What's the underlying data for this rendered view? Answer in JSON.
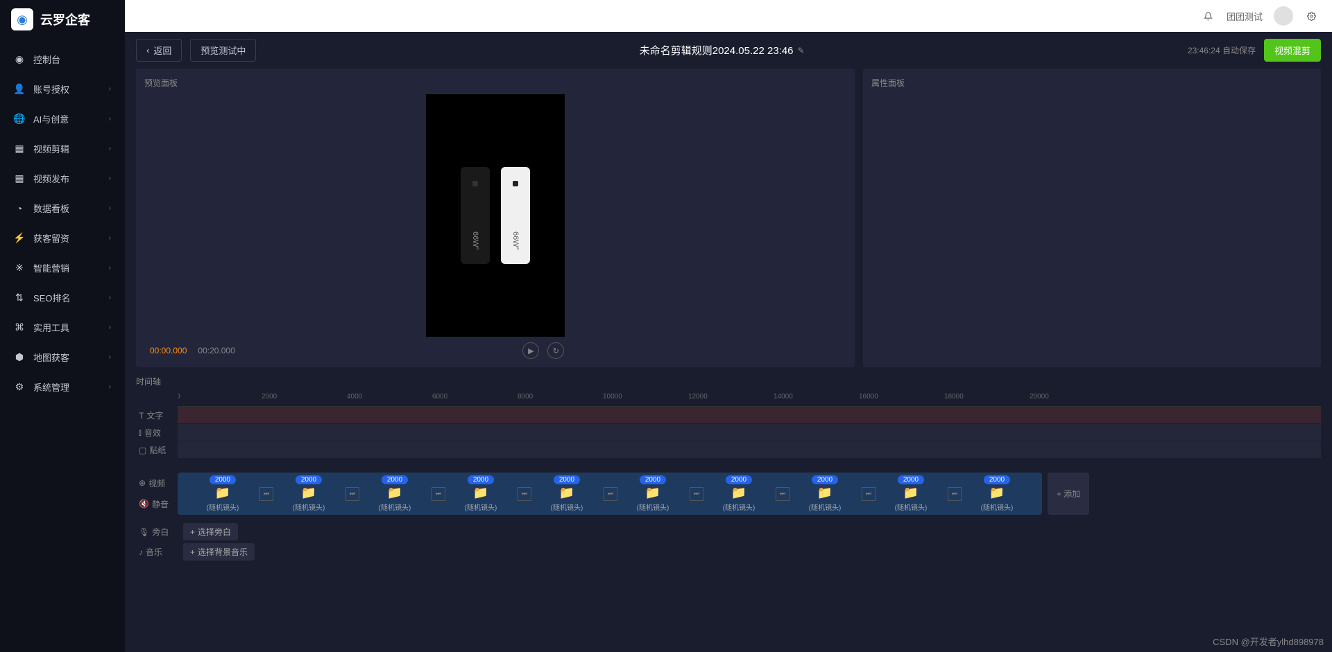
{
  "logo": "云罗企客",
  "nav": [
    {
      "icon": "dashboard",
      "label": "控制台",
      "expandable": false
    },
    {
      "icon": "user",
      "label": "账号授权",
      "expandable": true
    },
    {
      "icon": "globe",
      "label": "AI与创意",
      "expandable": true
    },
    {
      "icon": "film",
      "label": "视频剪辑",
      "expandable": true
    },
    {
      "icon": "grid",
      "label": "视频发布",
      "expandable": true
    },
    {
      "icon": "chart",
      "label": "数据看板",
      "expandable": true
    },
    {
      "icon": "leads",
      "label": "获客留资",
      "expandable": true
    },
    {
      "icon": "marketing",
      "label": "智能营销",
      "expandable": true
    },
    {
      "icon": "seo",
      "label": "SEO排名",
      "expandable": true
    },
    {
      "icon": "tools",
      "label": "实用工具",
      "expandable": true
    },
    {
      "icon": "map",
      "label": "地图获客",
      "expandable": true
    },
    {
      "icon": "gear",
      "label": "系统管理",
      "expandable": true
    }
  ],
  "topbar": {
    "user": "团团测试"
  },
  "header": {
    "back": "返回",
    "preview_test": "预览测试中",
    "title": "未命名剪辑规则2024.05.22 23:46",
    "autosave": "23:46:24 自动保存",
    "mix_btn": "视频混剪"
  },
  "panels": {
    "preview": "预览面板",
    "props": "属性面板"
  },
  "preview": {
    "cur": "00:00.000",
    "total": "00:20.000",
    "label_66w": "66W°"
  },
  "timeline": {
    "title": "时间轴",
    "ticks": [
      "0",
      "2000",
      "4000",
      "6000",
      "8000",
      "10000",
      "12000",
      "14000",
      "16000",
      "18000",
      "20000"
    ],
    "tracks": [
      {
        "icon": "T",
        "label": "文字"
      },
      {
        "icon": "bars",
        "label": "音效"
      },
      {
        "icon": "image",
        "label": "贴纸"
      }
    ]
  },
  "clips": {
    "labels": [
      {
        "icon": "globe",
        "label": "视频"
      },
      {
        "icon": "mute",
        "label": "静音"
      }
    ],
    "items": [
      {
        "dur": "2000",
        "name": "(随机镜头)"
      },
      {
        "dur": "2000",
        "name": "(随机镜头)"
      },
      {
        "dur": "2000",
        "name": "(随机镜头)"
      },
      {
        "dur": "2000",
        "name": "(随机镜头)"
      },
      {
        "dur": "2000",
        "name": "(随机镜头)"
      },
      {
        "dur": "2000",
        "name": "(随机镜头)"
      },
      {
        "dur": "2000",
        "name": "(随机镜头)"
      },
      {
        "dur": "2000",
        "name": "(随机镜头)"
      },
      {
        "dur": "2000",
        "name": "(随机镜头)"
      },
      {
        "dur": "2000",
        "name": "(随机镜头)"
      }
    ],
    "add": "+ 添加"
  },
  "actions": {
    "narration": {
      "label": "旁白",
      "btn": "选择旁白"
    },
    "music": {
      "label": "音乐",
      "btn": "选择背景音乐"
    }
  },
  "watermark": "CSDN @开发者ylhd898978"
}
